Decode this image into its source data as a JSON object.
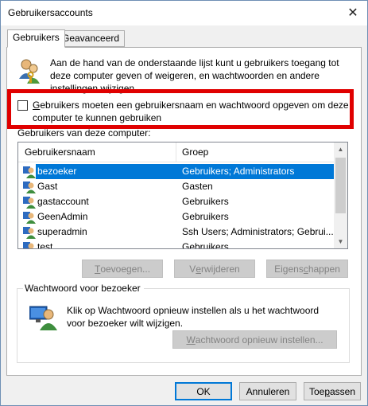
{
  "window": {
    "title": "Gebruikersaccounts",
    "close_glyph": "✕"
  },
  "tabs": [
    {
      "label": "Gebruikers",
      "active": true
    },
    {
      "label": "Geavanceerd",
      "active": false
    }
  ],
  "intro": {
    "text": "Aan de hand van de onderstaande lijst kunt u gebruikers toegang tot deze computer geven of weigeren, en wachtwoorden en andere instellingen wijzigen.",
    "icon": "users-icon"
  },
  "require_login": {
    "checked": false,
    "label_underlined_char": "G",
    "label_rest": "ebruikers moeten een gebruikersnaam en wachtwoord opgeven om deze computer te kunnen gebruiken",
    "highlight_color": "#e00000"
  },
  "users_list": {
    "caption": "Gebruikers van deze computer:",
    "columns": [
      "Gebruikersnaam",
      "Groep"
    ],
    "rows": [
      {
        "name": "bezoeker",
        "group": "Gebruikers; Administrators",
        "selected": true
      },
      {
        "name": "Gast",
        "group": "Gasten",
        "selected": false
      },
      {
        "name": "gastaccount",
        "group": "Gebruikers",
        "selected": false
      },
      {
        "name": "GeenAdmin",
        "group": "Gebruikers",
        "selected": false
      },
      {
        "name": "superadmin",
        "group": "Ssh Users; Administrators; Gebrui...",
        "selected": false
      },
      {
        "name": "test",
        "group": "Gebruikers",
        "selected": false
      }
    ],
    "selection_color": "#0078d7"
  },
  "list_buttons": {
    "add": {
      "u": "T",
      "rest": "oevoegen..."
    },
    "remove": {
      "pre": "V",
      "u": "e",
      "rest": "rwijderen"
    },
    "props": {
      "pre": "Eigens",
      "u": "c",
      "rest": "happen"
    }
  },
  "password_group": {
    "title": "Wachtwoord voor bezoeker",
    "text": "Klik op Wachtwoord opnieuw instellen als u het wachtwoord voor bezoeker wilt wijzigen.",
    "button": {
      "u": "W",
      "rest": "achtwoord opnieuw instellen..."
    }
  },
  "dialog_buttons": {
    "ok": "OK",
    "cancel": "Annuleren",
    "apply": {
      "pre": "Toe",
      "u": "p",
      "rest": "assen"
    }
  }
}
